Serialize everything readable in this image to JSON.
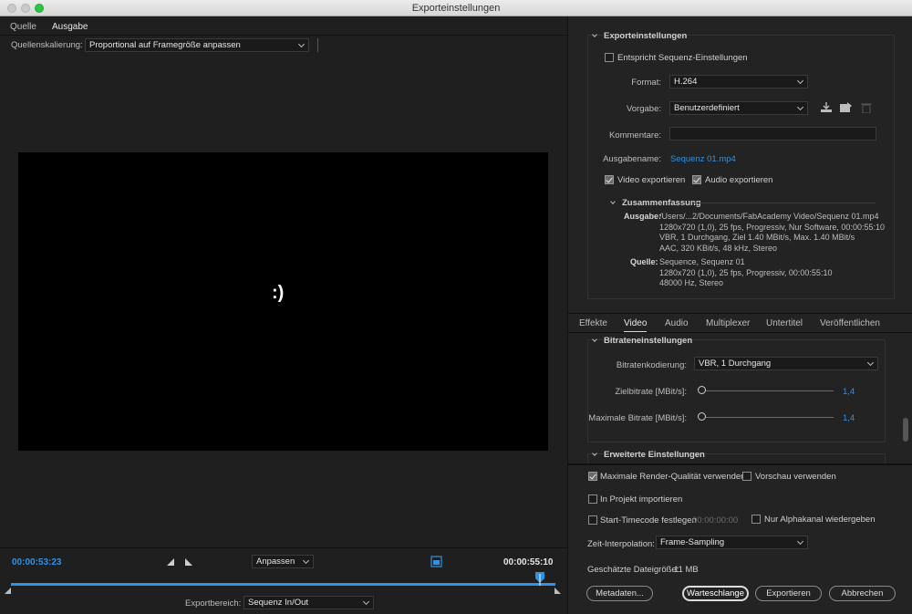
{
  "window": {
    "title": "Exporteinstellungen"
  },
  "left": {
    "tabs": [
      "Quelle",
      "Ausgabe"
    ],
    "scaling_label": "Quellenskalierung:",
    "scaling_value": "Proportional auf Framegröße anpassen",
    "preview_text": ":)"
  },
  "timeline": {
    "current_tc": "00:00:53:23",
    "end_tc": "00:00:55:10",
    "fit_value": "Anpassen",
    "range_label": "Exportbereich:",
    "range_value": "Sequenz In/Out",
    "playhead_fraction": 0.972,
    "accent": "#2e92e6"
  },
  "export": {
    "section_title": "Exporteinstellungen",
    "match_seq": "Entspricht Sequenz-Einstellungen",
    "format_label": "Format:",
    "format_value": "H.264",
    "preset_label": "Vorgabe:",
    "preset_value": "Benutzerdefiniert",
    "comments_label": "Kommentare:",
    "output_label": "Ausgabename:",
    "output_value": "Sequenz 01.mp4",
    "video_export": "Video exportieren",
    "audio_export": "Audio exportieren",
    "summary_title": "Zusammenfassung",
    "out_label": "Ausgabe:",
    "out_lines": [
      "/Users/...2/Documents/FabAcademy Video/Sequenz 01.mp4",
      "1280x720 (1,0), 25 fps, Progressiv, Nur Software, 00:00:55:10",
      "VBR, 1 Durchgang, Ziel 1.40 MBit/s, Max. 1.40 MBit/s",
      "AAC, 320 KBit/s, 48 kHz, Stereo"
    ],
    "src_label": "Quelle:",
    "src_lines": [
      "Sequence, Sequenz 01",
      "1280x720 (1,0), 25 fps, Progressiv, 00:00:55:10",
      "48000 Hz, Stereo"
    ]
  },
  "tabs2": {
    "items": [
      "Effekte",
      "Video",
      "Audio",
      "Multiplexer",
      "Untertitel",
      "Veröffentlichen"
    ],
    "active": "Video"
  },
  "bitrate": {
    "section_title": "Bitrateneinstellungen",
    "encoding_label": "Bitratenkodierung:",
    "encoding_value": "VBR, 1 Durchgang",
    "target_label": "Zielbitrate [MBit/s]:",
    "target_value": "1,4",
    "max_label": "Maximale Bitrate [MBit/s]:",
    "max_value": "1,4",
    "advanced_title": "Erweiterte Einstellungen"
  },
  "bottom": {
    "max_render": "Maximale Render-Qualität verwenden",
    "use_preview": "Vorschau verwenden",
    "import_project": "In Projekt importieren",
    "start_tc": "Start-Timecode festlegen",
    "start_tc_value": "00:00:00:00",
    "alpha_only": "Nur Alphakanal wiedergeben",
    "time_interp_label": "Zeit-Interpolation:",
    "time_interp_value": "Frame-Sampling",
    "filesize_label": "Geschätzte Dateigröße:",
    "filesize_value": "11 MB",
    "btn_metadata": "Metadaten...",
    "btn_queue": "Warteschlange",
    "btn_export": "Exportieren",
    "btn_cancel": "Abbrechen"
  }
}
